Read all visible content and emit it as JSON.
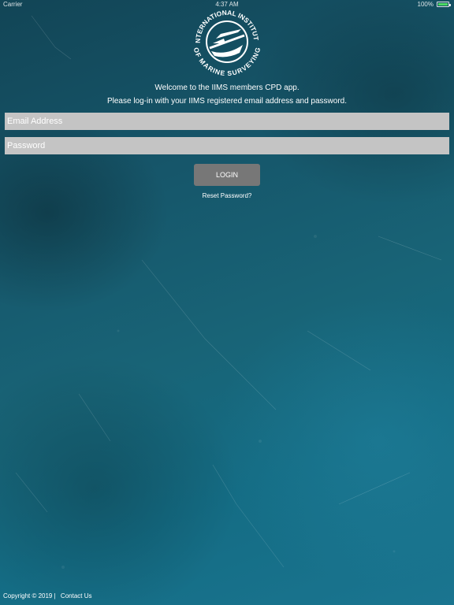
{
  "status_bar": {
    "carrier": "Carrier",
    "time": "4:37 AM",
    "battery": "100%"
  },
  "logo": {
    "top_text": "INTERNATIONAL INSTITUTE",
    "bottom_text": "OF MARINE SURVEYING"
  },
  "welcome": "Welcome to the IIMS members CPD app.",
  "instructions": "Please log-in with your IIMS registered email address and password.",
  "form": {
    "email_placeholder": "Email Address",
    "password_placeholder": "Password",
    "login_label": "LOGIN",
    "reset_label": "Reset Password?"
  },
  "footer": {
    "copyright": "Copyright © 2019 |",
    "contact": "Contact Us"
  },
  "colors": {
    "background": "#186477",
    "input_bg": "#c4c4c4",
    "button_bg": "#777777",
    "text": "#ffffff"
  }
}
